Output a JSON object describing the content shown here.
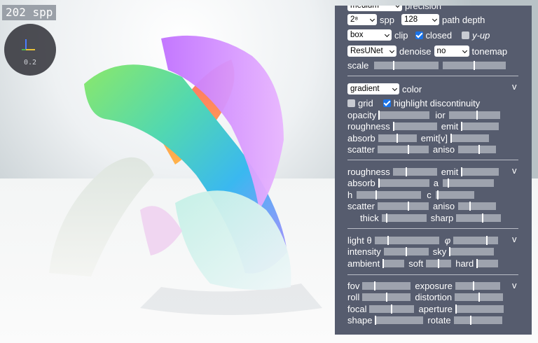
{
  "overlay": {
    "spp": "202 spp",
    "gizmo_value": "0.2"
  },
  "render": {
    "precision": "medium",
    "precision_label": "precision",
    "spp_value": "2⁸",
    "spp_label": "spp",
    "path_depth": "128",
    "path_depth_label": "path depth",
    "clip": "box",
    "clip_label": "clip",
    "closed_label": "closed",
    "closed_checked": true,
    "yup_label": "y-up",
    "yup_checked": false,
    "denoiser": "ResUNet",
    "denoise_label": "denoise",
    "tonemap": "no",
    "tonemap_label": "tonemap",
    "scale_label": "scale",
    "scale_level": 0.3,
    "scale2_level": 0.5
  },
  "material": {
    "color_mode": "gradient",
    "color_label": "color",
    "grid_label": "grid",
    "grid_checked": false,
    "highlight_label": "highlight discontinuity",
    "highlight_checked": true,
    "opacity_label": "opacity",
    "opacity_level": 0.0,
    "ior_label": "ior",
    "ior_level": 0.55,
    "roughness_label": "roughness",
    "roughness_level": 0.0,
    "emit_label": "emit",
    "emit_level": 0.0,
    "absorb_label": "absorb",
    "absorb_level": 0.5,
    "emitv_label": "emit[v]",
    "emitv_level": 0.0,
    "scatter_label": "scatter",
    "scatter_level": 0.6,
    "aniso_label": "aniso",
    "aniso_level": 0.55
  },
  "material2": {
    "roughness_label": "roughness",
    "roughness_level": 0.3,
    "emit_label": "emit",
    "emit_level": 0.0,
    "absorb_label": "absorb",
    "absorb_level": 0.0,
    "a_label": "a",
    "a_level": 0.1,
    "h_label": "h",
    "h_level": 0.3,
    "c_label": "c",
    "c_level": 0.05,
    "scatter_label": "scatter",
    "scatter_level": 0.6,
    "aniso_label": "aniso",
    "aniso_level": 0.3,
    "thick_label": "thick",
    "thick_level": 0.1,
    "sharp_label": "sharp",
    "sharp_level": 0.6
  },
  "lighting": {
    "theta_label": "light θ",
    "theta_level": 0.2,
    "phi_label": "φ",
    "phi_level": 0.75,
    "intensity_label": "intensity",
    "intensity_level": 0.5,
    "sky_label": "sky",
    "sky_level": 0.0,
    "ambient_label": "ambient",
    "ambient_level": 0.0,
    "soft_label": "soft",
    "soft_level": 0.5,
    "hard_label": "hard",
    "hard_level": 0.0
  },
  "camera": {
    "fov_label": "fov",
    "fov_level": 0.25,
    "exposure_label": "exposure",
    "exposure_level": 0.4,
    "roll_label": "roll",
    "roll_level": 0.5,
    "distortion_label": "distortion",
    "distortion_level": 0.5,
    "focal_label": "focal",
    "focal_level": 0.5,
    "aperture_label": "aperture",
    "aperture_level": 0.0,
    "shape_label": "shape",
    "shape_level": 0.0,
    "rotate_label": "rotate",
    "rotate_level": 0.35
  },
  "collapse_icon": "chevron-down-icon",
  "colors": {
    "panel": "#565c6e",
    "slider_track": "#9ea3ae",
    "checkbox_on": "#1a73e8",
    "overlay_bg": "#9aa0a8"
  }
}
